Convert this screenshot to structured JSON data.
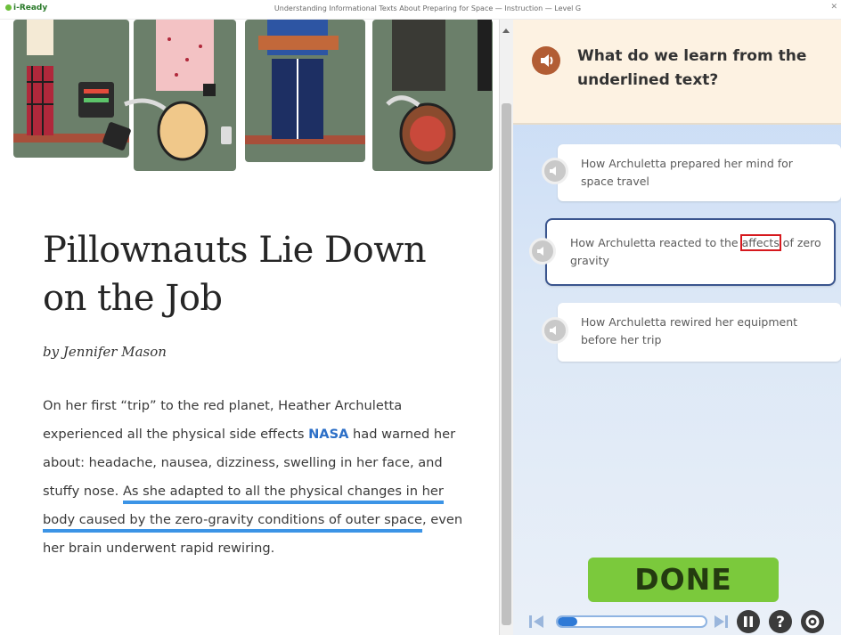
{
  "window": {
    "app_name": "i-Ready",
    "title": "Understanding Informational Texts About Preparing for Space — Instruction — Level G"
  },
  "article": {
    "title_line1": "Pillownauts Lie Down",
    "title_line2": "on the Job",
    "byline": "by Jennifer Mason",
    "body": {
      "p1": "On her first “trip” to the red planet, Heather Archuletta experienced all the physical side effects ",
      "nasa": "NASA",
      "p2": " had warned her about: headache, nausea, dizziness, swelling in her face, and stuffy nose. ",
      "underlined": "As she adapted to all the physical changes in her body caused by the zero-gravity conditions of outer space",
      "p3": ", even her brain underwent rapid rewiring."
    }
  },
  "question": {
    "text": "What do we learn from the underlined text?",
    "audio_icon": "speaker-icon"
  },
  "choices": [
    {
      "text": "How Archuletta prepared her mind for space travel",
      "selected": false
    },
    {
      "text_before": "How Archuletta reacted to the ",
      "highlight": "affects",
      "text_after": " of zero gravity",
      "selected": true
    },
    {
      "text": "How Archuletta rewired her equipment before her trip",
      "selected": false
    }
  ],
  "done_button": {
    "label": "DONE"
  },
  "controls": {
    "progress": 0.13,
    "icons": [
      "skip-back-icon",
      "skip-forward-icon",
      "pause-icon",
      "help-icon",
      "settings-icon"
    ]
  },
  "colors": {
    "underline": "#3c94e6",
    "nasa_link": "#2c6fc7",
    "done_green": "#7bc93c",
    "question_bg": "#fdf2e2",
    "selected_border": "#3a558e",
    "highlight_box": "#d6191e"
  }
}
